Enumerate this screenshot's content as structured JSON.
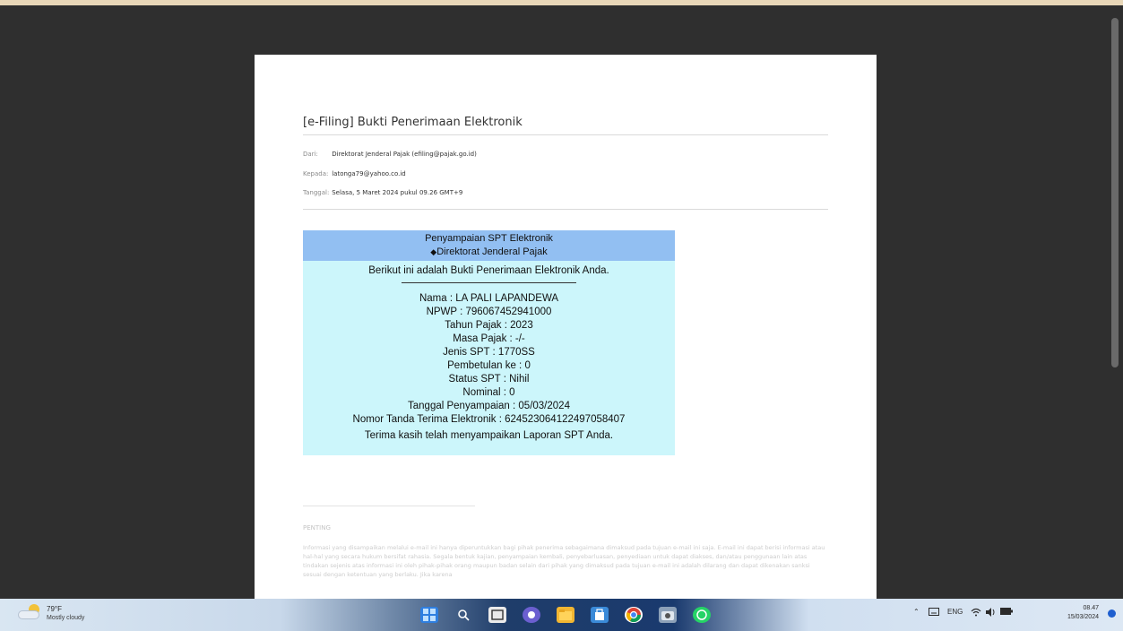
{
  "email": {
    "subject": "[e-Filing] Bukti Penerimaan Elektronik",
    "from_label": "Dari:",
    "from_value": "Direktorat Jenderal Pajak (efiling@pajak.go.id)",
    "to_label": "Kepada:",
    "to_value": "latonga79@yahoo.co.id",
    "date_label": "Tanggal:",
    "date_value": "Selasa, 5 Maret 2024 pukul 09.26 GMT+9"
  },
  "receipt": {
    "header_line1": "Penyampaian SPT Elektronik",
    "header_line2": "Direktorat Jenderal Pajak",
    "intro": "Berikut ini adalah Bukti Penerimaan Elektronik Anda.",
    "rows": [
      "Nama : LA PALI LAPANDEWA",
      "NPWP : 796067452941000",
      "Tahun Pajak : 2023",
      "Masa Pajak : -/-",
      "Jenis SPT : 1770SS",
      "Pembetulan ke : 0",
      "Status SPT : Nihil",
      "Nominal : 0",
      "Tanggal Penyampaian : 05/03/2024",
      "Nomor Tanda Terima Elektronik : 6245230641224970​58407"
    ],
    "thanks": "Terima kasih telah menyampaikan Laporan SPT Anda."
  },
  "footer": {
    "penting": "PENTING",
    "disclaimer": "Informasi yang disampaikan melalui e-mail ini hanya diperuntukkan bagi pihak penerima sebagaimana dimaksud pada tujuan e-mail ini saja. E-mail ini dapat berisi informasi atau hal-hal yang secara hukum bersifat rahasia. Segala bentuk kajian, penyampaian kembali, penyebarluasan, penyediaan untuk dapat diakses, dan/atau penggunaan lain atas tindakan sejenis atas informasi ini oleh pihak-pihak orang maupun badan selain dari pihak yang dimaksud pada tujuan e-mail ini adalah dilarang dan dapat dikenakan sanksi sesuai dengan ketentuan yang berlaku. Jika karena"
  },
  "taskbar": {
    "weather_temp": "79°F",
    "weather_desc": "Mostly cloudy",
    "lang": "ENG",
    "time": "08.47",
    "date": "15/03/2024"
  },
  "colors": {
    "receipt_header": "#92bff2",
    "receipt_body": "#ccf6fb",
    "viewer_bg": "#2f2f2f"
  }
}
